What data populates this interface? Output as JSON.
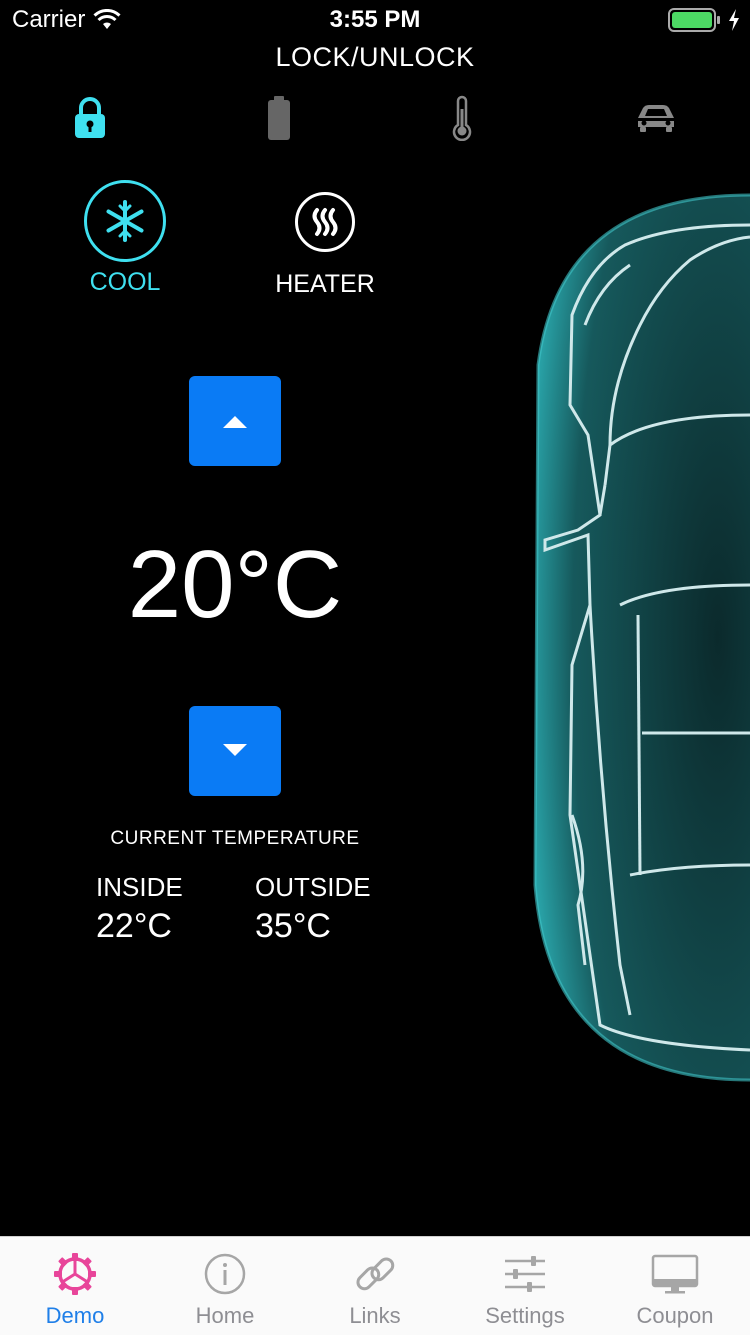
{
  "status_bar": {
    "carrier": "Carrier",
    "time": "3:55 PM"
  },
  "header": {
    "title": "LOCK/UNLOCK"
  },
  "top_icons": [
    "lock-icon",
    "battery-icon",
    "thermometer-icon",
    "car-icon"
  ],
  "modes": {
    "cool_label": "COOL",
    "heater_label": "HEATER",
    "active": "cool"
  },
  "temperature": {
    "set_value": "20°C"
  },
  "current_temperature": {
    "title": "CURRENT TEMPERATURE",
    "inside_label": "INSIDE",
    "inside_value": "22°C",
    "outside_label": "OUTSIDE",
    "outside_value": "35°C"
  },
  "tabs": [
    {
      "label": "Demo",
      "icon": "gear-icon",
      "active": true
    },
    {
      "label": "Home",
      "icon": "info-icon",
      "active": false
    },
    {
      "label": "Links",
      "icon": "link-icon",
      "active": false
    },
    {
      "label": "Settings",
      "icon": "sliders-icon",
      "active": false
    },
    {
      "label": "Coupon",
      "icon": "monitor-icon",
      "active": false
    }
  ],
  "colors": {
    "accent": "#3fe0f0",
    "button": "#0a7bf5",
    "tab_active": "#1f7fe8",
    "demo_icon": "#e8459a"
  }
}
